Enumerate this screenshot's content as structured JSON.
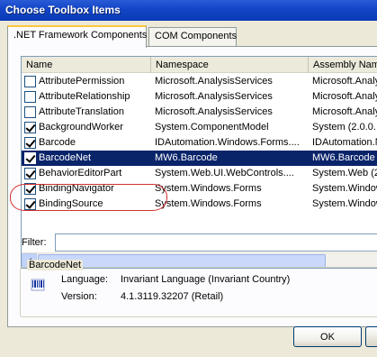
{
  "window": {
    "title": "Choose Toolbox Items"
  },
  "tabs": [
    {
      "label": ".NET Framework Components",
      "active": true
    },
    {
      "label": "COM Components",
      "active": false
    }
  ],
  "grid": {
    "columns": [
      "Name",
      "Namespace",
      "Assembly Name"
    ],
    "rows": [
      {
        "checked": false,
        "name": "AttributePermission",
        "namespace": "Microsoft.AnalysisServices",
        "assembly": "Microsoft.Analy",
        "selected": false
      },
      {
        "checked": false,
        "name": "AttributeRelationship",
        "namespace": "Microsoft.AnalysisServices",
        "assembly": "Microsoft.Analy",
        "selected": false
      },
      {
        "checked": false,
        "name": "AttributeTranslation",
        "namespace": "Microsoft.AnalysisServices",
        "assembly": "Microsoft.Analy",
        "selected": false
      },
      {
        "checked": true,
        "name": "BackgroundWorker",
        "namespace": "System.ComponentModel",
        "assembly": "System (2.0.0.",
        "selected": false
      },
      {
        "checked": true,
        "name": "Barcode",
        "namespace": "IDAutomation.Windows.Forms....",
        "assembly": "IDAutomation.N",
        "selected": false
      },
      {
        "checked": true,
        "name": "BarcodeNet",
        "namespace": "MW6.Barcode",
        "assembly": "MW6.Barcode (",
        "selected": true
      },
      {
        "checked": true,
        "name": "BehaviorEditorPart",
        "namespace": "System.Web.UI.WebControls....",
        "assembly": "System.Web (2.",
        "selected": false
      },
      {
        "checked": true,
        "name": "BindingNavigator",
        "namespace": "System.Windows.Forms",
        "assembly": "System.Window",
        "selected": false
      },
      {
        "checked": true,
        "name": "BindingSource",
        "namespace": "System.Windows.Forms",
        "assembly": "System.Window",
        "selected": false
      }
    ]
  },
  "filter": {
    "label": "Filter:",
    "value": ""
  },
  "details": {
    "title": "BarcodeNet",
    "icon": "barcode-icon",
    "language_label": "Language:",
    "language_value": "Invariant Language (Invariant Country)",
    "version_label": "Version:",
    "version_value": "4.1.3119.32207 (Retail)"
  },
  "buttons": {
    "ok": "OK"
  }
}
